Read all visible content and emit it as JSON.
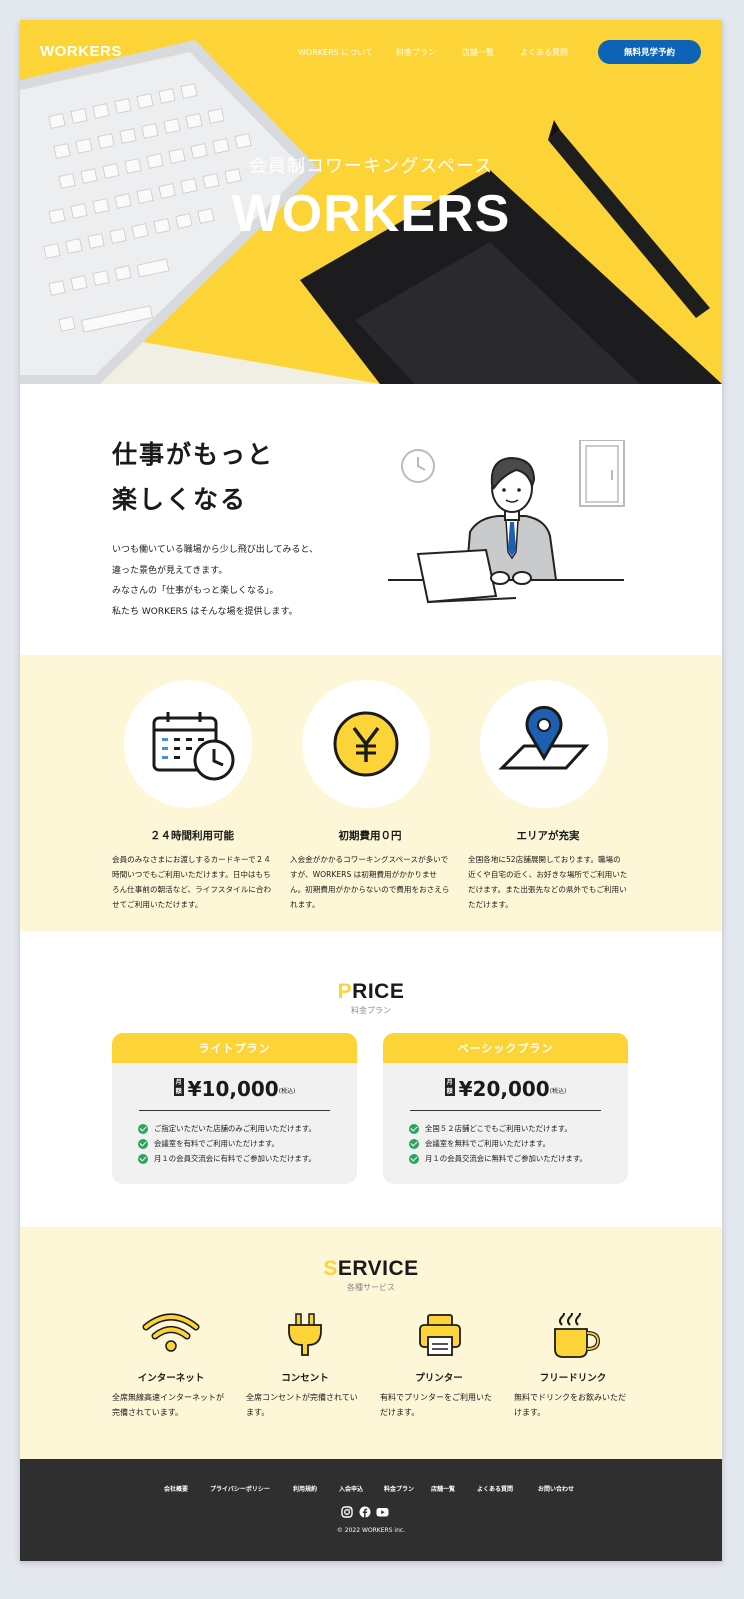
{
  "header": {
    "logo": "WORKERS",
    "nav": [
      "WORKERS について",
      "料金プラン",
      "店舗一覧",
      "よくある質問"
    ],
    "cta": "無料見学予約"
  },
  "hero": {
    "subtitle": "会員制コワーキングスペース",
    "title": "WORKERS"
  },
  "intro": {
    "title_lines": [
      "仕事がもっと",
      "楽しくなる"
    ],
    "text_lines": [
      "いつも働いている職場から少し飛び出してみると、",
      "違った景色が見えてきます。",
      "みなさんの「仕事がもっと楽しくなる」。",
      "私たち WORKERS はそんな場を提供します。"
    ]
  },
  "features": [
    {
      "icon": "calendar-clock-icon",
      "title": "２４時間利用可能",
      "text": "会員のみなさまにお渡しするカードキーで２４時間いつでもご利用いただけます。日中はもちろん仕事前の朝活など、ライフスタイルに合わせてご利用いただけます。"
    },
    {
      "icon": "yen-coin-icon",
      "title": "初期費用０円",
      "text": "入会金がかかるコワーキングスペースが多いですが、WORKERS は初期費用がかかりません。初期費用がかからないので費用をおさえられます。"
    },
    {
      "icon": "map-pin-icon",
      "title": "エリアが充実",
      "text": "全国各地に52店舗展開しております。職場の近くや自宅の近く、お好きな場所でご利用いただけます。また出張先などの県外でもご利用いただけます。"
    }
  ],
  "price": {
    "title_first": "P",
    "title_rest": "RICE",
    "subtitle": "料金プラン",
    "plans": [
      {
        "name": "ライトプラン",
        "tag": "月額",
        "amount": "¥10,000",
        "tax": "(税込)",
        "items": [
          "ご指定いただいた店舗のみご利用いただけます。",
          "会議室を有料でご利用いただけます。",
          "月１の会員交流会に有料でご参加いただけます。"
        ]
      },
      {
        "name": "ベーシックプラン",
        "tag": "月額",
        "amount": "¥20,000",
        "tax": "(税込)",
        "items": [
          "全国５２店舗どこでもご利用いただけます。",
          "会議室を無料でご利用いただけます。",
          "月１の会員交流会に無料でご参加いただけます。"
        ]
      }
    ]
  },
  "service": {
    "title_first": "S",
    "title_rest": "ERVICE",
    "subtitle": "各種サービス",
    "items": [
      {
        "icon": "wifi-icon",
        "title": "インターネット",
        "text": "全席無線高速インターネットが完備されています。"
      },
      {
        "icon": "plug-icon",
        "title": "コンセント",
        "text": "全席コンセントが完備されています。"
      },
      {
        "icon": "printer-icon",
        "title": "プリンター",
        "text": "有料でプリンターをご利用いただけます。"
      },
      {
        "icon": "coffee-icon",
        "title": "フリードリンク",
        "text": "無料でドリンクをお飲みいただけます。"
      }
    ]
  },
  "footer": {
    "links": [
      "会社概要",
      "プライバシーポリシー",
      "利用規約",
      "入会申込",
      "料金プラン",
      "店舗一覧",
      "よくある質問",
      "お問い合わせ"
    ],
    "social": [
      "instagram-icon",
      "facebook-icon",
      "youtube-icon"
    ],
    "copyright": "© 2022 WORKERS inc."
  },
  "colors": {
    "yellow": "#fcd437",
    "cream": "#fdf6d7",
    "blue": "#0d63b6",
    "green": "#2da35b",
    "footer": "#2f2f2f"
  }
}
